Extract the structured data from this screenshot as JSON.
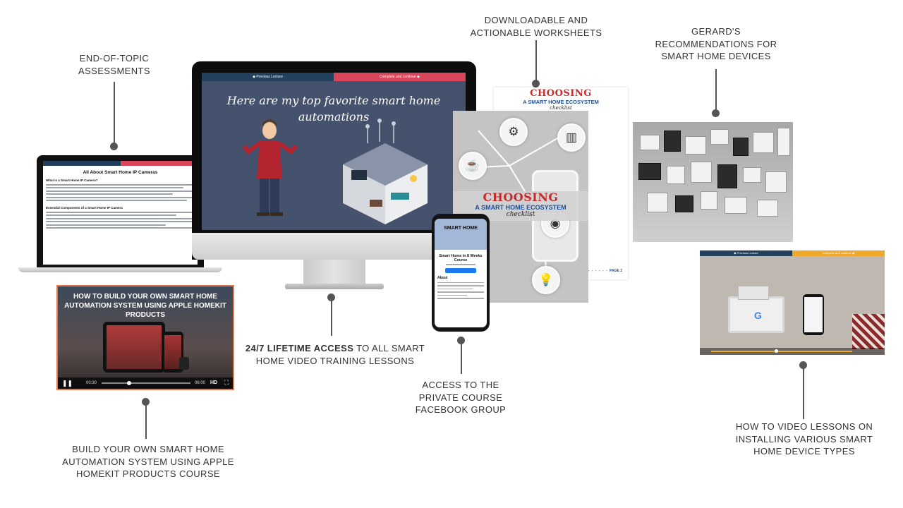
{
  "callouts": {
    "assessments": [
      "END-OF-TOPIC",
      "ASSESSMENTS"
    ],
    "worksheets": [
      "DOWNLOADABLE AND",
      "ACTIONABLE WORKSHEETS"
    ],
    "recommendations": [
      "GERARD'S",
      "RECOMMENDATIONS FOR",
      "SMART HOME DEVICES"
    ],
    "lifetime_bold": "24/7 LIFETIME ACCESS",
    "lifetime_rest": " TO ALL SMART",
    "lifetime_line2": "HOME VIDEO TRAINING LESSONS",
    "facebook": [
      "ACCESS TO THE",
      "PRIVATE COURSE",
      "FACEBOOK GROUP"
    ],
    "homekit": [
      "BUILD YOUR OWN SMART HOME",
      "AUTOMATION SYSTEM USING APPLE",
      "HOMEKIT PRODUCTS COURSE"
    ],
    "howto": [
      "HOW TO VIDEO LESSONS ON",
      "INSTALLING VARIOUS SMART",
      "HOME DEVICE TYPES"
    ]
  },
  "laptop": {
    "title": "All About Smart Home IP Cameras",
    "heading1": "What is a Smart Home IP Camera?",
    "heading2": "Essential Components of a Smart Home IP Camera"
  },
  "imac": {
    "prev": "◆ Previous Lecture",
    "next": "Complete and continue ◆",
    "headline_line1": "Here are my top favorite smart home",
    "headline_line2": "automations"
  },
  "video": {
    "title_line1": "HOW TO BUILD YOUR OWN SMART HOME",
    "title_line2": "AUTOMATION SYSTEM USING APPLE HOMEKIT PRODUCTS",
    "time_start": "00:30",
    "time_end": "06:00",
    "hd": "HD"
  },
  "worksheet": {
    "title_a": "CHOOSING",
    "title_b": "A SMART HOME ECOSYSTEM",
    "title_c": "checklist",
    "page": "PAGE 2"
  },
  "phone": {
    "banner": "SMART HOME",
    "group_title": "Smart Home in 8 Weeks Course",
    "about": "About"
  },
  "icons": [
    "mixer-icon",
    "fridge-icon",
    "coffee-maker-icon",
    "wifi-icon",
    "lightbulb-icon"
  ],
  "colors": {
    "accent_red": "#d9455a",
    "navy": "#23405d",
    "orange": "#e7774a",
    "gold": "#f0a82b"
  }
}
